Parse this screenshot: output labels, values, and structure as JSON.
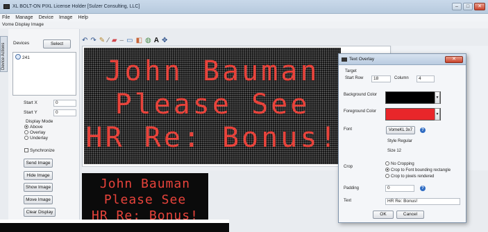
{
  "window": {
    "title": "XL BOLT-ON PIXL   License Holder [Sulzer Consulting, LLC]",
    "controls": {
      "minimize": "–",
      "maximize": "□",
      "close": "✕"
    }
  },
  "menu": [
    "File",
    "Manage",
    "Device",
    "Image",
    "Help"
  ],
  "panel_title": "Vorne Display Image",
  "side_tab": "Device Actions",
  "left": {
    "devices_label": "Devices",
    "select_button": "Select",
    "device_item": "241",
    "start_x_label": "Start X",
    "start_x_value": "0",
    "start_y_label": "Start Y",
    "start_y_value": "0",
    "display_mode_label": "Display Mode",
    "modes": [
      "Above",
      "Overlay",
      "Underlay"
    ],
    "selected_mode": "Above",
    "synchronize_label": "Synchronize",
    "buttons": [
      "Send Image",
      "Hide Image",
      "Show Image",
      "Move Image",
      "Clear Display"
    ]
  },
  "toolbar_icons": [
    "undo-icon",
    "redo-icon",
    "pencil-icon",
    "line-icon",
    "eraser-icon",
    "dash-icon",
    "rectangle-icon",
    "fill-icon",
    "shape-icon",
    "text-icon",
    "move-icon"
  ],
  "led_main": [
    "John Bauman",
    "Please See",
    "HR Re: Bonus!"
  ],
  "led_preview": [
    "John Bauman",
    "Please See",
    "HR Re: Bonus!"
  ],
  "colors": {
    "led_text": "#e8433b",
    "foreground": "#e8262a",
    "background": "#000000"
  },
  "dialog": {
    "title": "Text Overlay",
    "close_label": "✕",
    "target_label": "Target",
    "start_row_label": "Start  Row",
    "start_row_value": "18",
    "column_label": "Column",
    "column_value": "4",
    "background_color_label": "Background Color",
    "foreground_color_label": "Foreground Color",
    "font_label": "Font",
    "font_button": "VorneKL 3x7",
    "style_line": "Style  Regular",
    "size_line": "Size   12",
    "crop_label": "Crop",
    "crop_options": [
      "No Cropping",
      "Crop to Font bounding rectangle",
      "Crop to pixels rendered"
    ],
    "crop_selected": "Crop to Font bounding rectangle",
    "padding_label": "Padding",
    "padding_value": "0",
    "text_label": "Text",
    "text_value": "HR Re: Bonus!",
    "ok_label": "OK",
    "cancel_label": "Cancel"
  }
}
